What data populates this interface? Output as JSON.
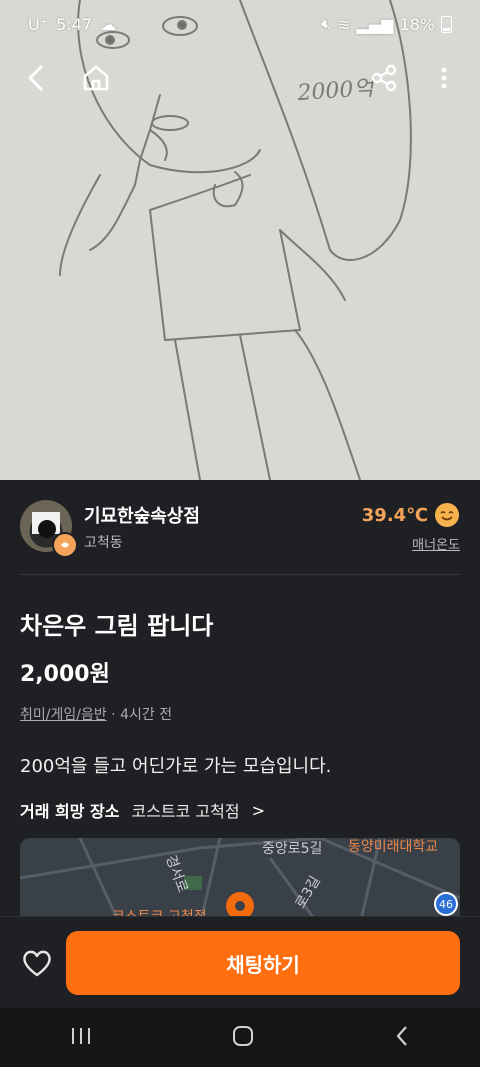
{
  "status_bar": {
    "carrier": "U⁺",
    "time": "5:47",
    "battery": "18%"
  },
  "hero": {
    "sketch_text": "2000억"
  },
  "nav": {
    "back_icon": "back-arrow-icon",
    "home_icon": "home-icon",
    "share_icon": "share-icon",
    "more_icon": "more-vertical-icon"
  },
  "seller": {
    "name": "기묘한숲속상점",
    "location": "고척동",
    "temperature": "39.4℃",
    "manner_label": "매너온도",
    "temp_color": "#f3a45a"
  },
  "product": {
    "title": "차은우 그림 팝니다",
    "price": "2,000원",
    "category": "취미/게임/음반",
    "time_ago": "4시간 전",
    "description": "200억을 들고 어딘가로 가는 모습입니다."
  },
  "trade": {
    "label": "거래 희망 장소",
    "place": "코스트코 고척점",
    "chevron": ">"
  },
  "map": {
    "labels": [
      "중앙로5길",
      "동양미래대학교",
      "경서로",
      "로3길",
      "코스트코 고척점"
    ],
    "route_number": "46"
  },
  "bottom": {
    "chat_button": "채팅하기",
    "accent": "#ff6f0f"
  }
}
